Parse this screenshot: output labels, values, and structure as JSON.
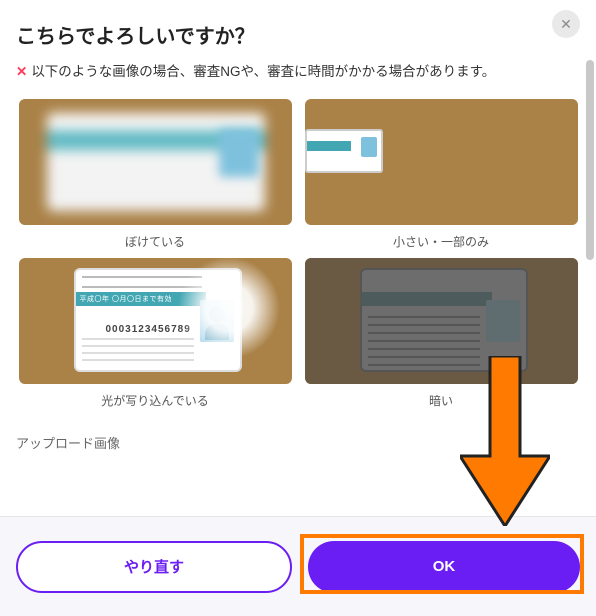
{
  "title": "こちらでよろしいですか？",
  "warning": {
    "x": "✕",
    "text": "以下のような画像の場合、審査NGや、審査に時間がかかる場合があります。"
  },
  "examples": [
    {
      "caption": "ぼけている"
    },
    {
      "caption": "小さい・一部のみ"
    },
    {
      "caption": "光が写り込んでいる"
    },
    {
      "caption": "暗い"
    }
  ],
  "card_sample": {
    "band_text": "平成〇年 〇月〇日まで有効",
    "number": "0003123456789"
  },
  "upload_label": "アップロード画像",
  "buttons": {
    "retry": "やり直す",
    "ok": "OK"
  },
  "colors": {
    "accent": "#6b1ef3",
    "highlight": "#ff7a00",
    "thumb_bg": "#aa8248"
  }
}
